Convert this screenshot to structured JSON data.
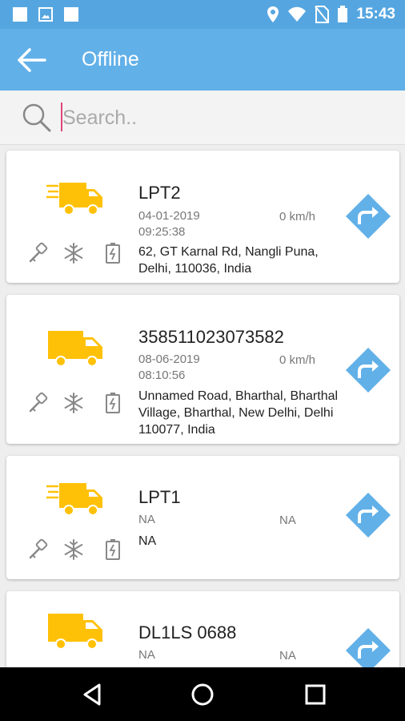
{
  "status_bar": {
    "time": "15:43",
    "left_icons": [
      "notification-square-icon",
      "image-icon",
      "notification-square-icon"
    ],
    "right_icons": [
      "location-icon",
      "wifi-icon",
      "no-sim-icon",
      "battery-icon"
    ]
  },
  "app_bar": {
    "title": "Offline",
    "back_icon": "arrow-left-icon"
  },
  "search": {
    "placeholder": "Search..",
    "value": ""
  },
  "vehicles": [
    {
      "name": "LPT2",
      "date": "04-01-2019",
      "time": "09:25:38",
      "speed": "0 km/h",
      "address": "62, GT Karnal Rd, Nangli Puna, Delhi, 110036, India"
    },
    {
      "name": "358511023073582",
      "date": "08-06-2019",
      "time": "08:10:56",
      "speed": "0 km/h",
      "address": "Unnamed Road, Bharthal, Bharthal Village, Bharthal, New Delhi, Delhi 110077, India"
    },
    {
      "name": "LPT1",
      "date": "NA",
      "time": "",
      "speed": "NA",
      "address": "NA"
    },
    {
      "name": "DL1LS 0688",
      "date": "NA",
      "time": "",
      "speed": "NA",
      "address": ""
    }
  ],
  "colors": {
    "status_bar": "#55a6e0",
    "app_bar": "#62b0e8",
    "truck": "#ffc107",
    "navigate": "#62b0e8",
    "device_icon": "#888888"
  },
  "system_nav": [
    "back-triangle-icon",
    "home-circle-icon",
    "recents-square-icon"
  ]
}
